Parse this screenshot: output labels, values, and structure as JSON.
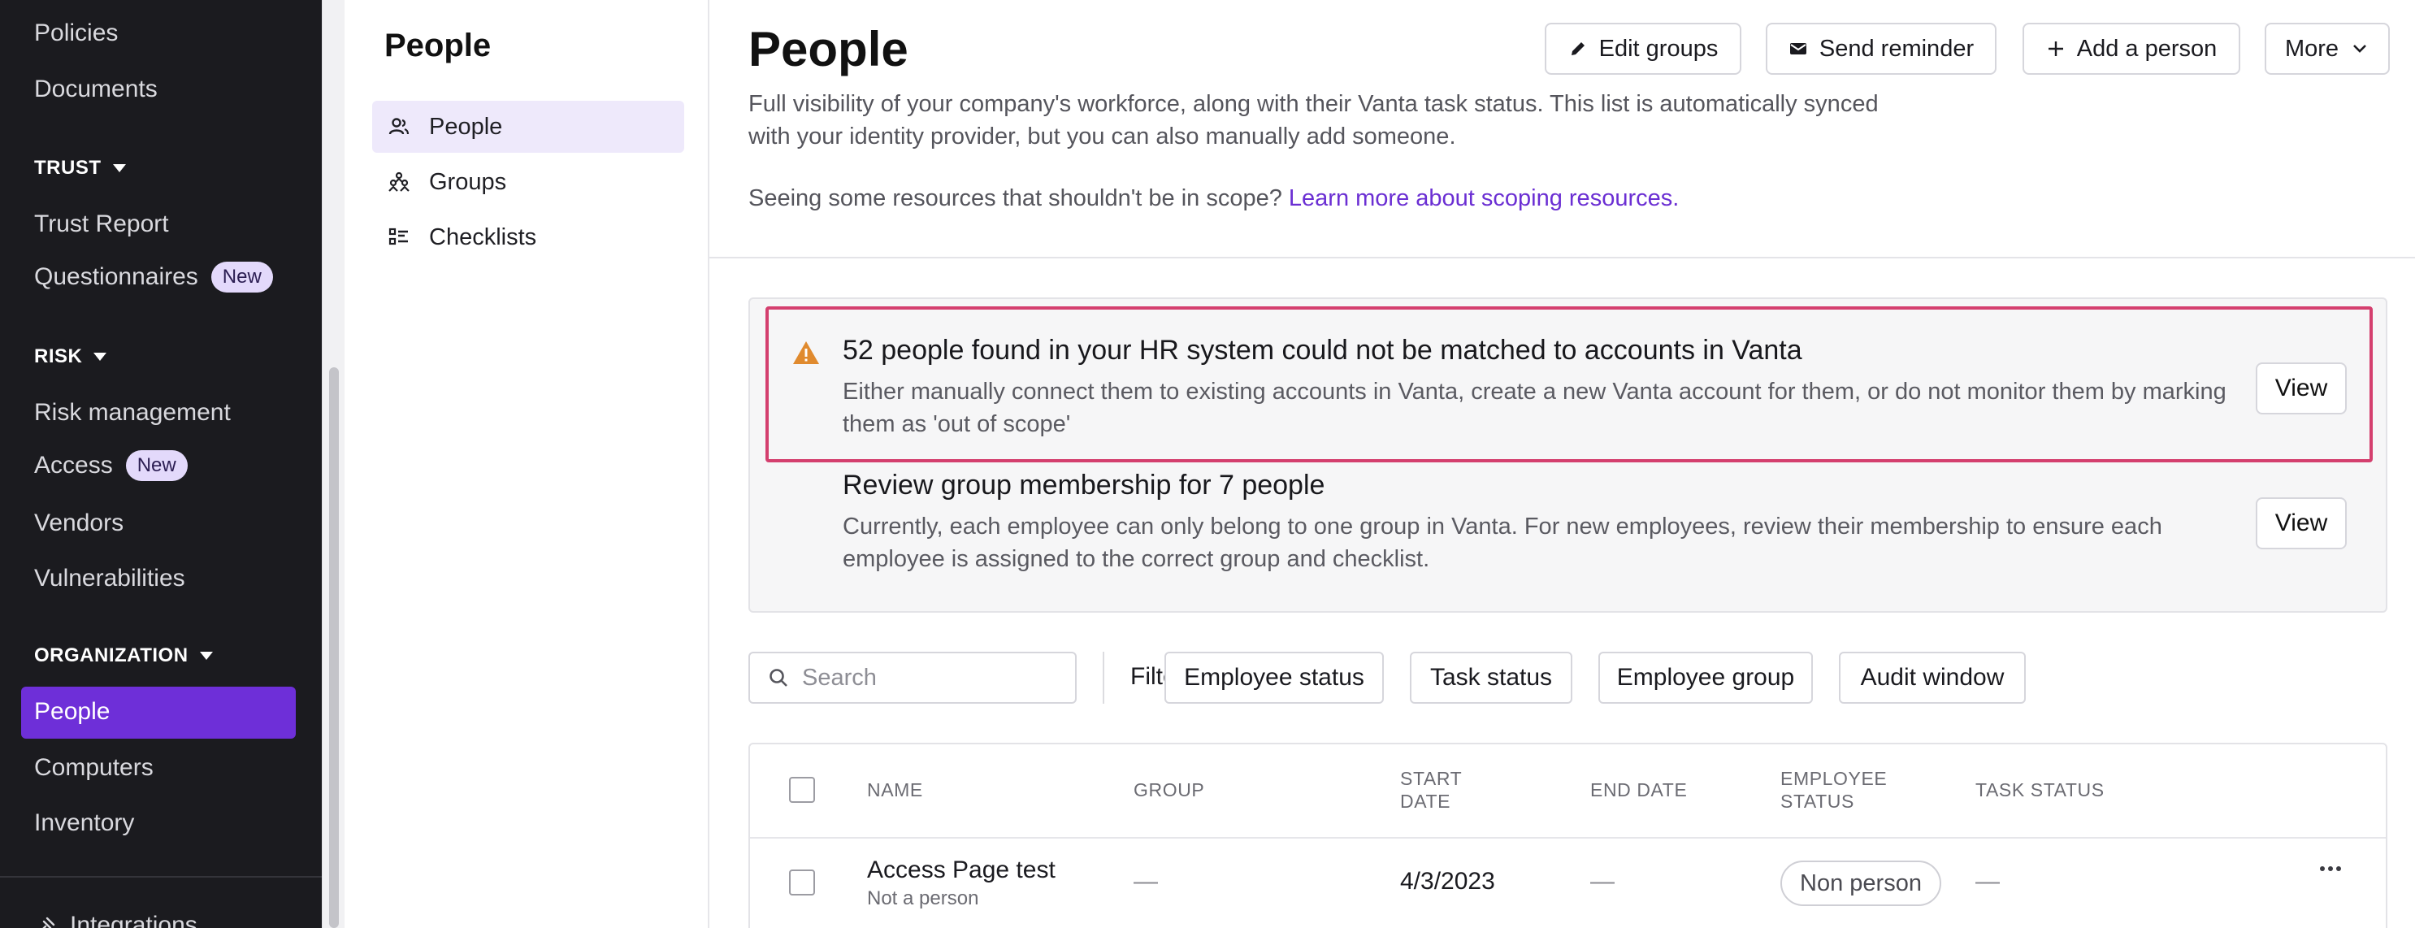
{
  "sidebar": {
    "items_top": [
      "Policies",
      "Documents"
    ],
    "trust": {
      "heading": "TRUST",
      "items": [
        "Trust Report",
        "Questionnaires"
      ]
    },
    "risk": {
      "heading": "RISK",
      "items": [
        "Risk management",
        "Access",
        "Vendors",
        "Vulnerabilities"
      ]
    },
    "organization": {
      "heading": "ORGANIZATION",
      "items": [
        "People",
        "Computers",
        "Inventory"
      ]
    },
    "new_badge": "New",
    "footer_item": "Integrations",
    "active_color": "#6e2fd8"
  },
  "subnav": {
    "title": "People",
    "items": [
      {
        "label": "People",
        "icon": "people-icon"
      },
      {
        "label": "Groups",
        "icon": "groups-icon"
      },
      {
        "label": "Checklists",
        "icon": "checklist-icon"
      }
    ]
  },
  "header": {
    "title": "People",
    "buttons": {
      "edit_groups": "Edit groups",
      "send_reminder": "Send reminder",
      "add_person": "Add a person",
      "more": "More"
    },
    "description": "Full visibility of your company's workforce, along with their Vanta task status. This list is automatically synced with your identity provider, but you can also manually add someone.",
    "scope_text": "Seeing some resources that shouldn't be in scope?",
    "scope_link": "Learn more about scoping resources."
  },
  "alerts": [
    {
      "title": "52 people found in your HR system could not be matched to accounts in Vanta",
      "body": "Either manually connect them to existing accounts in Vanta, create a new Vanta account for them, or do not monitor them by marking them as 'out of scope'",
      "action": "View"
    },
    {
      "title": "Review group membership for 7 people",
      "body": "Currently, each employee can only belong to one group in Vanta. For new employees, review their membership to ensure each employee is assigned to the correct group and checklist.",
      "action": "View"
    }
  ],
  "filters": {
    "search_placeholder": "Search",
    "label": "Filter by",
    "chips": [
      "Employee status",
      "Task status",
      "Employee group",
      "Audit window"
    ]
  },
  "table": {
    "columns": [
      "NAME",
      "GROUP",
      "START DATE",
      "END DATE",
      "EMPLOYEE STATUS",
      "TASK STATUS"
    ],
    "rows": [
      {
        "name": "Access Page test",
        "subtitle": "Not a person",
        "group": "—",
        "start_date": "4/3/2023",
        "end_date": "—",
        "employee_status": "Non person",
        "task_status": "—"
      }
    ]
  }
}
